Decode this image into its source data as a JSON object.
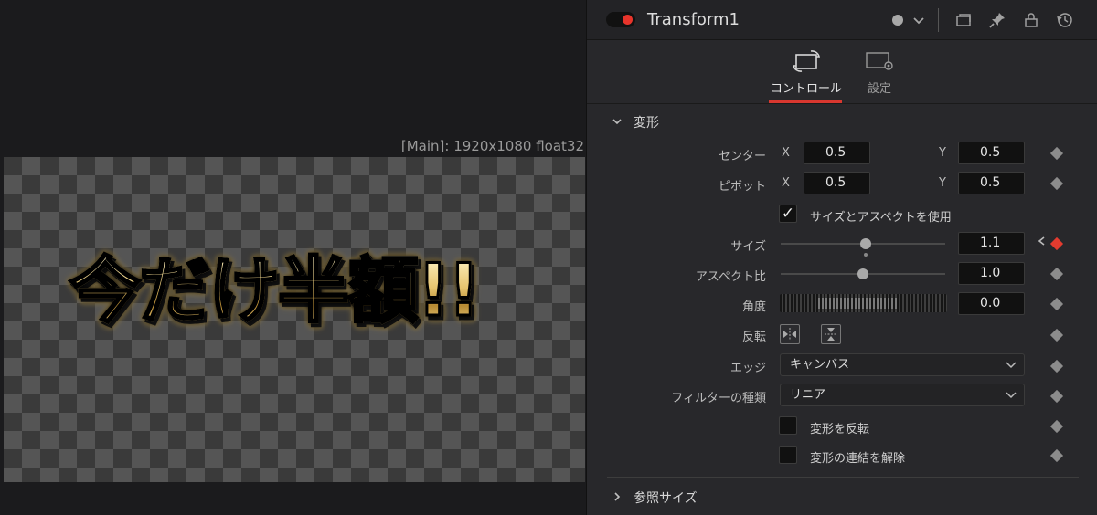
{
  "viewer": {
    "info": "[Main]: 1920x1080 float32",
    "overlay_text": "今だけ半額!!"
  },
  "inspector": {
    "node_title": "Transform1",
    "header_icons": [
      "dot-icon",
      "chevron-down-icon",
      "window-icon",
      "pin-icon",
      "lock-icon",
      "reset-icon"
    ],
    "tabs": [
      {
        "label": "コントロール",
        "active": true,
        "icon": "transform-icon"
      },
      {
        "label": "設定",
        "active": false,
        "icon": "settings-icon"
      }
    ],
    "section_transform": "変形",
    "section_reference": "参照サイズ",
    "center": {
      "label": "センター",
      "x_label": "X",
      "x": "0.5",
      "y_label": "Y",
      "y": "0.5"
    },
    "pivot": {
      "label": "ピボット",
      "x_label": "X",
      "x": "0.5",
      "y_label": "Y",
      "y": "0.5"
    },
    "use_size_aspect": {
      "label": "サイズとアスペクトを使用",
      "checked": true,
      "mark": "✓"
    },
    "size": {
      "label": "サイズ",
      "value": "1.1"
    },
    "aspect": {
      "label": "アスペクト比",
      "value": "1.0"
    },
    "angle": {
      "label": "角度",
      "value": "0.0"
    },
    "flip": {
      "label": "反転"
    },
    "edges": {
      "label": "エッジ",
      "value": "キャンバス"
    },
    "filter": {
      "label": "フィルターの種類",
      "value": "リニア"
    },
    "invert": {
      "label": "変形を反転",
      "checked": false
    },
    "flatten": {
      "label": "変形の連結を解除",
      "checked": false
    },
    "colors": {
      "accent": "#d8372f",
      "keyframe_active": "#e33b2f"
    }
  }
}
